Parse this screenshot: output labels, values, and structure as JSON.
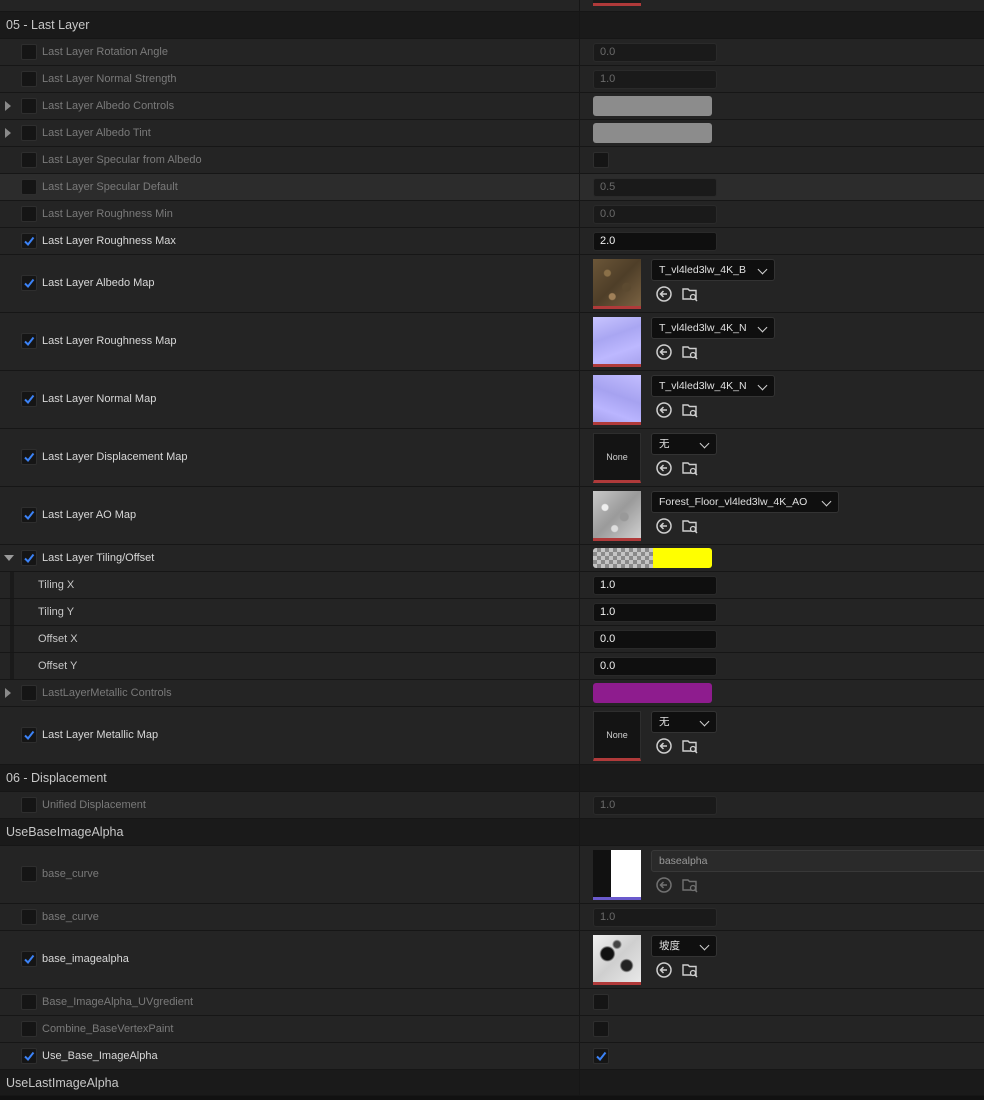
{
  "sections": {
    "last_layer": "05 - Last Layer",
    "displacement": "06 - Displacement",
    "use_base_alpha": "UseBaseImageAlpha",
    "use_last_alpha": "UseLastImageAlpha"
  },
  "params": {
    "rotation_angle": {
      "label": "Last Layer Rotation Angle",
      "value": "0.0"
    },
    "normal_strength": {
      "label": "Last Layer Normal Strength",
      "value": "1.0"
    },
    "albedo_controls": {
      "label": "Last Layer Albedo Controls"
    },
    "albedo_tint": {
      "label": "Last Layer Albedo Tint"
    },
    "specular_from_albedo": {
      "label": "Last Layer Specular from Albedo"
    },
    "specular_default": {
      "label": "Last Layer Specular Default",
      "value": "0.5"
    },
    "roughness_min": {
      "label": "Last Layer Roughness Min",
      "value": "0.0"
    },
    "roughness_max": {
      "label": "Last Layer Roughness Max",
      "value": "2.0"
    },
    "albedo_map": {
      "label": "Last Layer Albedo Map",
      "asset": "T_vl4led3lw_4K_B"
    },
    "roughness_map": {
      "label": "Last Layer Roughness Map",
      "asset": "T_vl4led3lw_4K_N"
    },
    "normal_map": {
      "label": "Last Layer Normal Map",
      "asset": "T_vl4led3lw_4K_N"
    },
    "displacement_map": {
      "label": "Last Layer Displacement Map",
      "asset": "无",
      "thumb": "None"
    },
    "ao_map": {
      "label": "Last Layer AO Map",
      "asset": "Forest_Floor_vl4led3lw_4K_AO"
    },
    "tiling_offset": {
      "label": "Last Layer Tiling/Offset"
    },
    "tiling_x": {
      "label": "Tiling X",
      "value": "1.0"
    },
    "tiling_y": {
      "label": "Tiling Y",
      "value": "1.0"
    },
    "offset_x": {
      "label": "Offset X",
      "value": "0.0"
    },
    "offset_y": {
      "label": "Offset Y",
      "value": "0.0"
    },
    "metallic_controls": {
      "label": "LastLayerMetallic Controls"
    },
    "metallic_map": {
      "label": "Last Layer Metallic Map",
      "asset": "无",
      "thumb": "None"
    },
    "unified_displacement": {
      "label": "Unified Displacement",
      "value": "1.0"
    },
    "base_curve_tex": {
      "label": "base_curve",
      "asset": "basealpha"
    },
    "base_curve_num": {
      "label": "base_curve",
      "value": "1.0"
    },
    "base_imagealpha": {
      "label": "base_imagealpha",
      "asset": "坡度"
    },
    "uv_gradient": {
      "label": "Base_ImageAlpha_UVgredient"
    },
    "combine_vertex": {
      "label": "Combine_BaseVertexPaint"
    },
    "use_base_imagealpha": {
      "label": "Use_Base_ImageAlpha"
    }
  },
  "colors": {
    "albedo_controls": "#8c8c8c",
    "albedo_tint": "#8c8c8c",
    "tiling_offset_color": "#ffff00",
    "metallic_controls": "#8e1c8e",
    "check_blue": "#3b82f6"
  },
  "icons": [
    "checkmark-icon",
    "expand-arrow-icon",
    "use-selected-asset-icon",
    "browse-asset-icon",
    "chevron-down-icon"
  ]
}
